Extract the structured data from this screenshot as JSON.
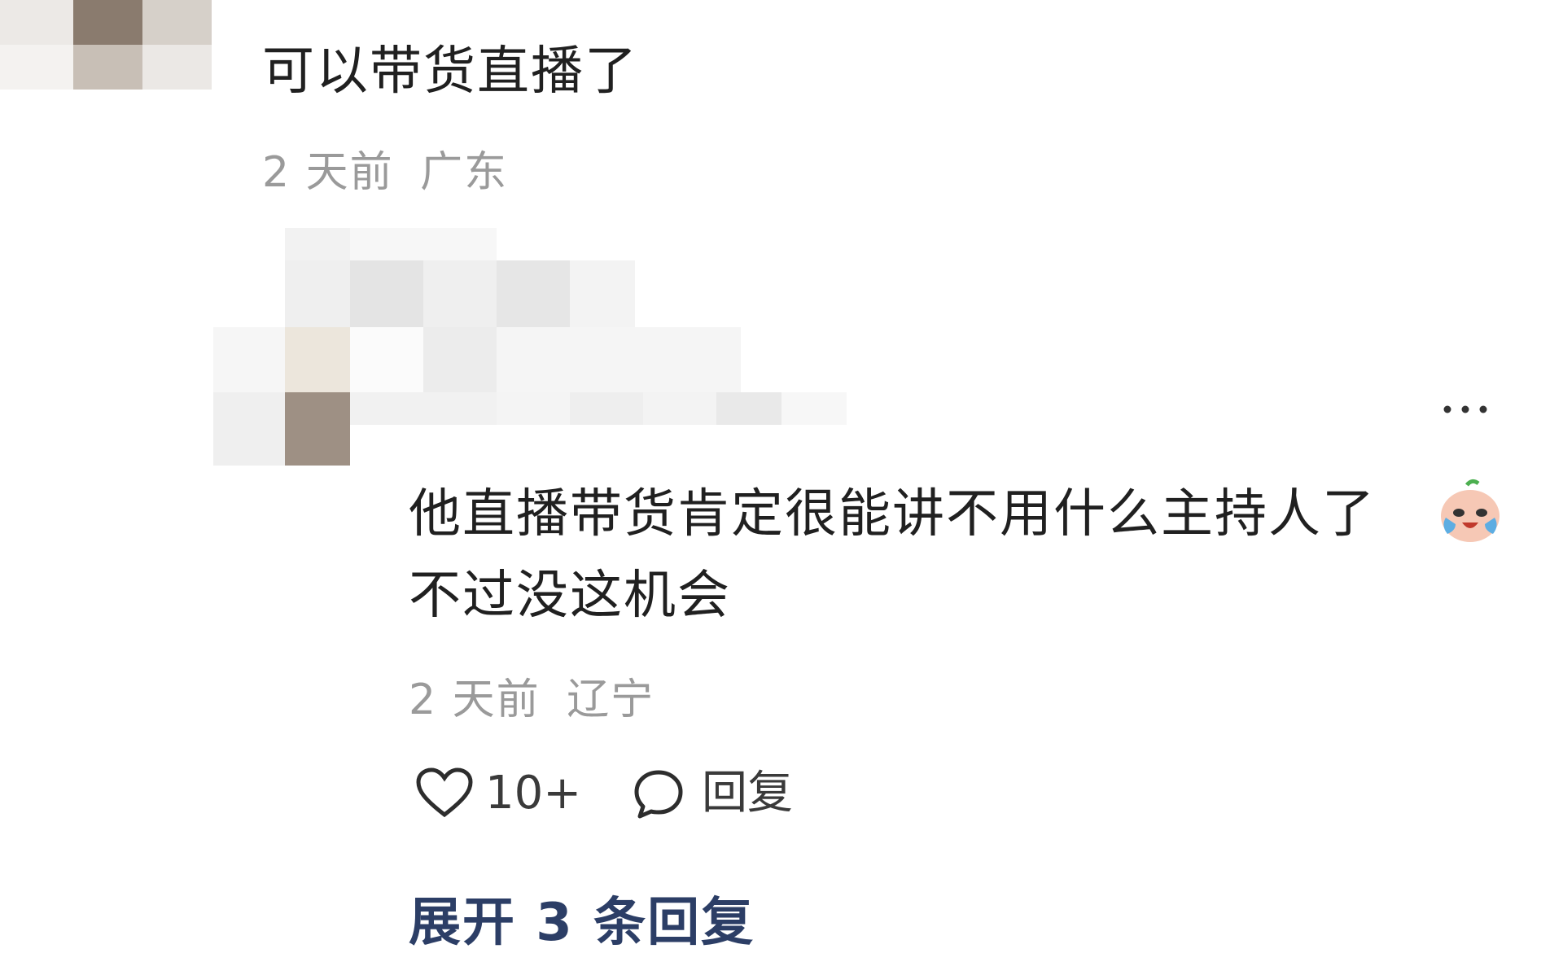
{
  "comment1": {
    "text": "可以带货直播了",
    "time": "2 天前",
    "location": "广东"
  },
  "reply1": {
    "more_icon": "more-dots-icon",
    "text_line1": "他直播带货肯定很能讲不用什么主持人了",
    "emoji_icon": "crying-laughing-emoji-icon",
    "text_line2": "不过没这机会",
    "time": "2 天前",
    "location": "辽宁",
    "like_icon": "heart-icon",
    "like_count": "10+",
    "reply_icon": "comment-bubble-icon",
    "reply_label": "回复"
  },
  "expand_label": "展开 3 条回复"
}
